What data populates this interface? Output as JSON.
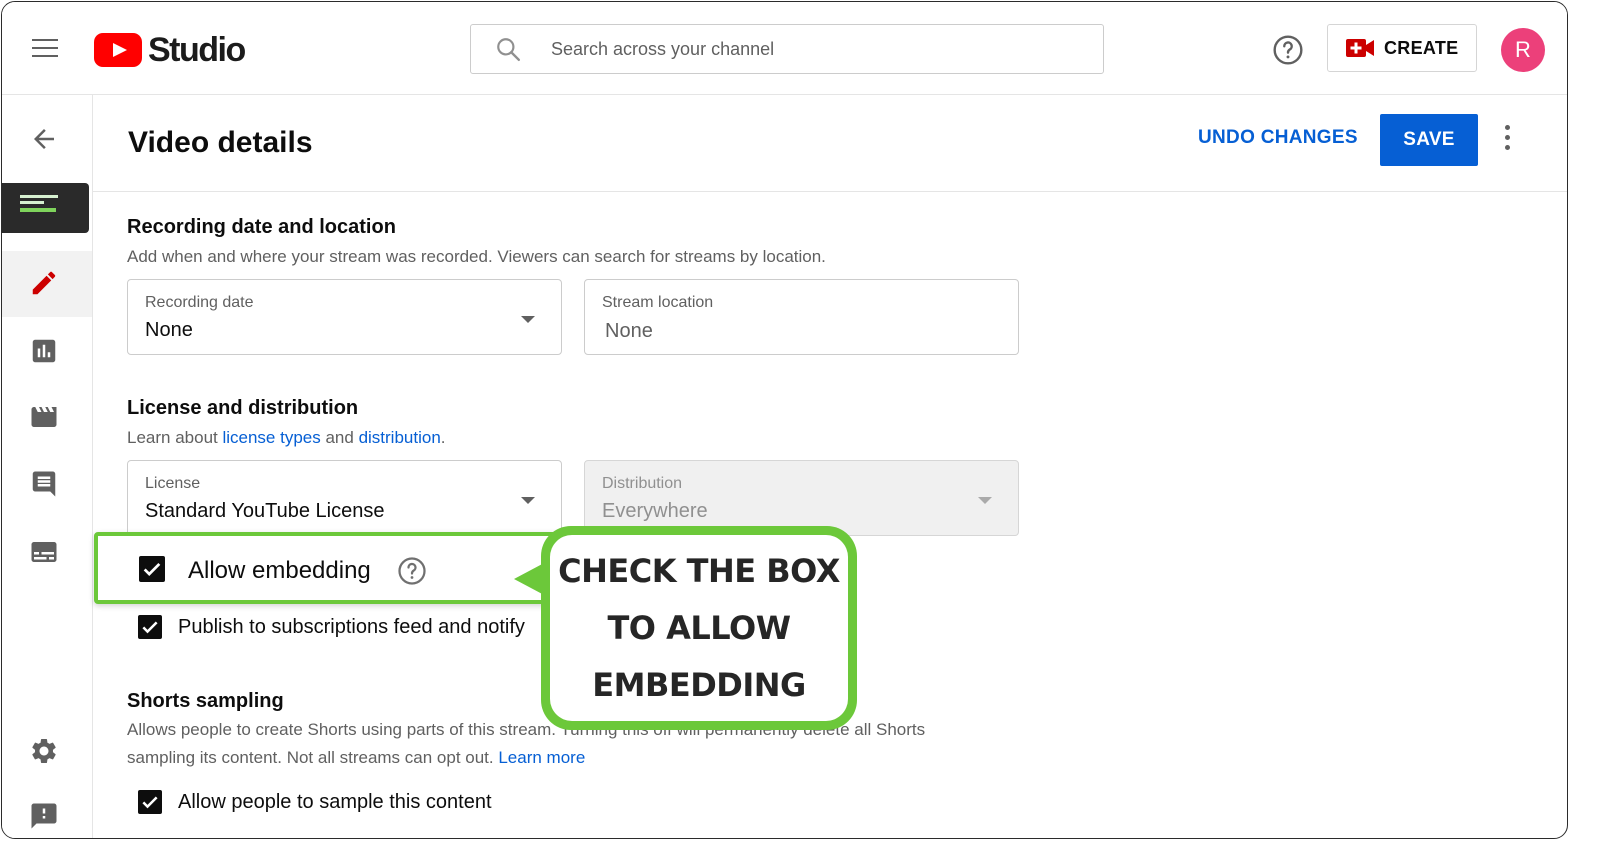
{
  "header": {
    "logo_text": "Studio",
    "search_placeholder": "Search across your channel",
    "create_label": "CREATE",
    "avatar_initial": "R"
  },
  "page": {
    "title": "Video details",
    "undo_label": "UNDO CHANGES",
    "save_label": "SAVE"
  },
  "recording": {
    "title": "Recording date and location",
    "description": "Add when and where your stream was recorded. Viewers can search for streams by location.",
    "date_label": "Recording date",
    "date_value": "None",
    "location_label": "Stream location",
    "location_value": "None"
  },
  "license": {
    "title": "License and distribution",
    "desc_prefix": "Learn about ",
    "desc_link1": "license types",
    "desc_mid": " and ",
    "desc_link2": "distribution",
    "desc_suffix": ".",
    "license_label": "License",
    "license_value": "Standard YouTube License",
    "distribution_label": "Distribution",
    "distribution_value": "Everywhere",
    "allow_embedding": "Allow embedding",
    "publish_label": "Publish to subscriptions feed and notify"
  },
  "shorts": {
    "title": "Shorts sampling",
    "description_line1": "Allows people to create Shorts using parts of this stream. Turning this off will permanently delete all Shorts",
    "description_line2_prefix": "sampling its content. Not all streams can opt out. ",
    "learn_more": "Learn more",
    "allow_sampling": "Allow people to sample this content"
  },
  "callout": {
    "line1": "CHECK THE BOX",
    "line2": "TO ALLOW",
    "line3": "EMBEDDING"
  },
  "colors": {
    "accent_blue": "#065fd4",
    "brand_red": "#ff0000",
    "highlight_green": "#6cc83a",
    "avatar_pink": "#ec407a"
  },
  "icons": [
    "menu-icon",
    "search-icon",
    "help-icon",
    "create-video-icon",
    "back-arrow-icon",
    "edit-pencil-icon",
    "analytics-icon",
    "editor-clapper-icon",
    "comments-icon",
    "subtitles-icon",
    "settings-gear-icon",
    "feedback-icon",
    "more-vert-icon",
    "checkbox-checked-icon",
    "dropdown-caret-icon"
  ]
}
